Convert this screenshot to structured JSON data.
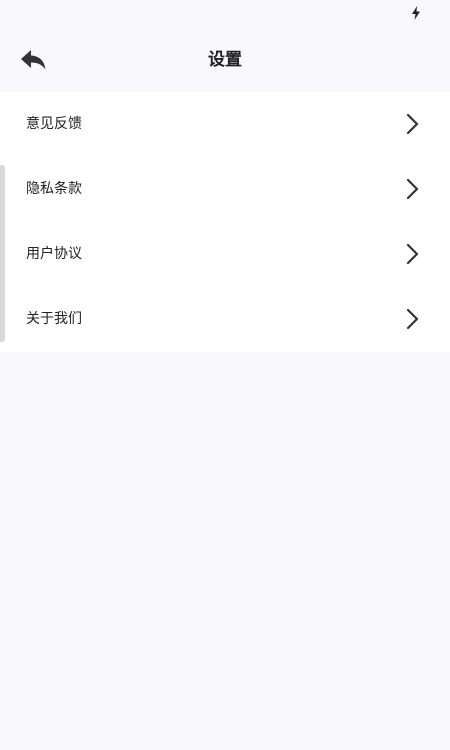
{
  "status_bar": {
    "icon": "charging-bolt-icon"
  },
  "header": {
    "title": "设置",
    "back_icon": "back-arrow-icon"
  },
  "menu": {
    "items": [
      {
        "label": "意见反馈",
        "icon": "chevron-right-icon"
      },
      {
        "label": "隐私条款",
        "icon": "chevron-right-icon"
      },
      {
        "label": "用户协议",
        "icon": "chevron-right-icon"
      },
      {
        "label": "关于我们",
        "icon": "chevron-right-icon"
      }
    ]
  },
  "colors": {
    "background": "#f9f8fd",
    "card": "#ffffff",
    "text": "#222222",
    "scroll_indicator": "#d9d9d9"
  }
}
